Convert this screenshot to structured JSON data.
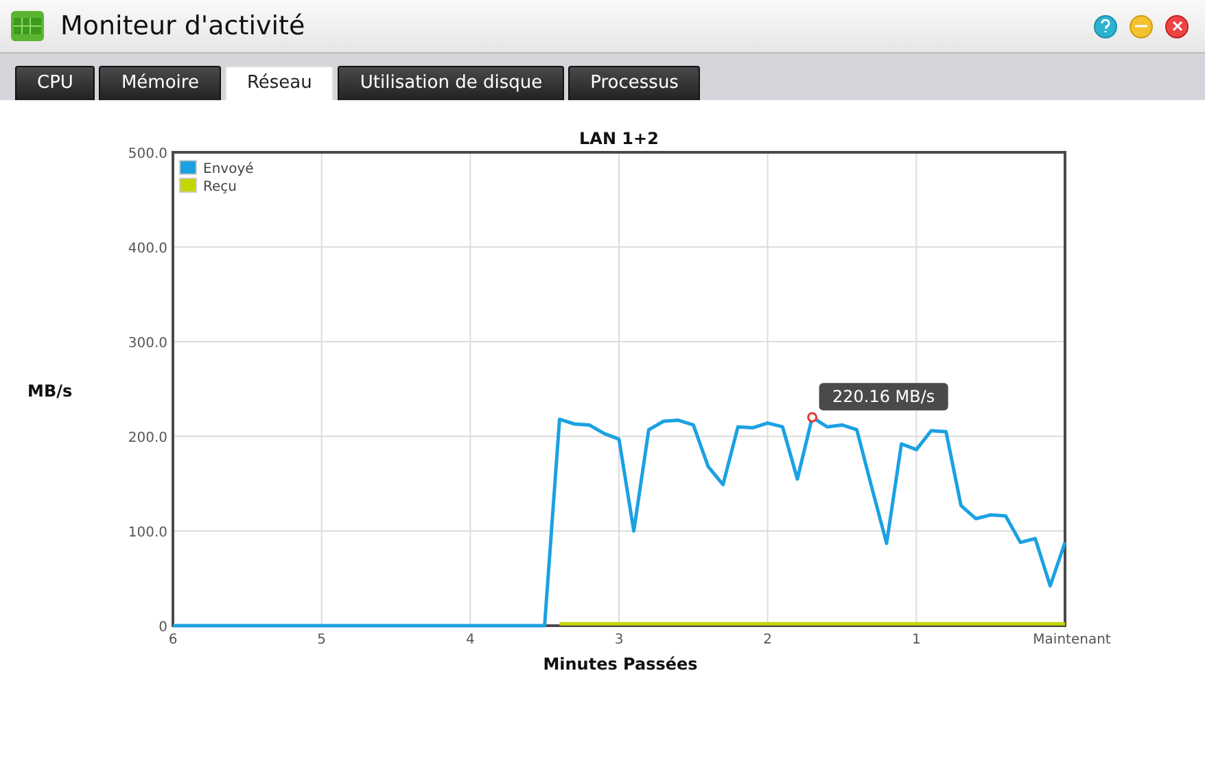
{
  "window": {
    "title": "Moniteur d'activité"
  },
  "tabs": [
    {
      "label": "CPU",
      "selected": false
    },
    {
      "label": "Mémoire",
      "selected": false
    },
    {
      "label": "Réseau",
      "selected": true
    },
    {
      "label": "Utilisation de disque",
      "selected": false
    },
    {
      "label": "Processus",
      "selected": false
    }
  ],
  "chart": {
    "chart_data": {
      "type": "line",
      "title": "LAN 1+2",
      "xlabel": "Minutes Passées",
      "ylabel": "MB/s",
      "x": [
        6,
        3.5,
        3.4,
        3.3,
        3.2,
        3.1,
        3.0,
        2.9,
        2.8,
        2.7,
        2.6,
        2.5,
        2.4,
        2.3,
        2.2,
        2.1,
        2.0,
        1.9,
        1.8,
        1.7,
        1.6,
        1.5,
        1.4,
        1.3,
        1.2,
        1.1,
        1.0,
        0.9,
        0.8,
        0.7,
        0.6,
        0.5,
        0.4,
        0.3,
        0.2,
        0.1,
        0
      ],
      "series": [
        {
          "name": "Envoyé",
          "color": "#1ba1e2",
          "values": [
            0,
            0,
            218,
            213,
            212,
            203,
            197,
            100,
            207,
            216,
            217,
            212,
            168,
            149,
            210,
            209,
            214,
            210,
            155,
            220,
            210,
            212,
            207,
            146,
            87,
            192,
            186,
            206,
            205,
            127,
            113,
            117,
            116,
            88,
            92,
            42,
            88
          ]
        },
        {
          "name": "Reçu",
          "color": "#c4d600",
          "values": [
            null,
            null,
            2,
            2,
            2,
            2,
            2,
            2,
            2,
            2,
            2,
            2,
            2,
            2,
            2,
            2,
            2,
            2,
            2,
            2,
            2,
            2,
            2,
            2,
            2,
            2,
            2,
            2,
            2,
            2,
            2,
            2,
            2,
            2,
            2,
            2,
            2
          ]
        }
      ],
      "grid": true,
      "legend": true,
      "xlim": [
        6,
        0
      ],
      "ylim": [
        0,
        500
      ],
      "xticks": [
        {
          "value": 6,
          "label": "6"
        },
        {
          "value": 5,
          "label": "5"
        },
        {
          "value": 4,
          "label": "4"
        },
        {
          "value": 3,
          "label": "3"
        },
        {
          "value": 2,
          "label": "2"
        },
        {
          "value": 1,
          "label": "1"
        },
        {
          "value": 0,
          "label": "Maintenant"
        }
      ],
      "yticks": [
        {
          "value": 0,
          "label": "0"
        },
        {
          "value": 100,
          "label": "100.0"
        },
        {
          "value": 200,
          "label": "200.0"
        },
        {
          "value": 300,
          "label": "300.0"
        },
        {
          "value": 400,
          "label": "400.0"
        },
        {
          "value": 500,
          "label": "500.0"
        }
      ],
      "annotations": [
        {
          "x": 1.7,
          "y": 220.16,
          "text": "220.16 MB/s"
        }
      ]
    }
  }
}
